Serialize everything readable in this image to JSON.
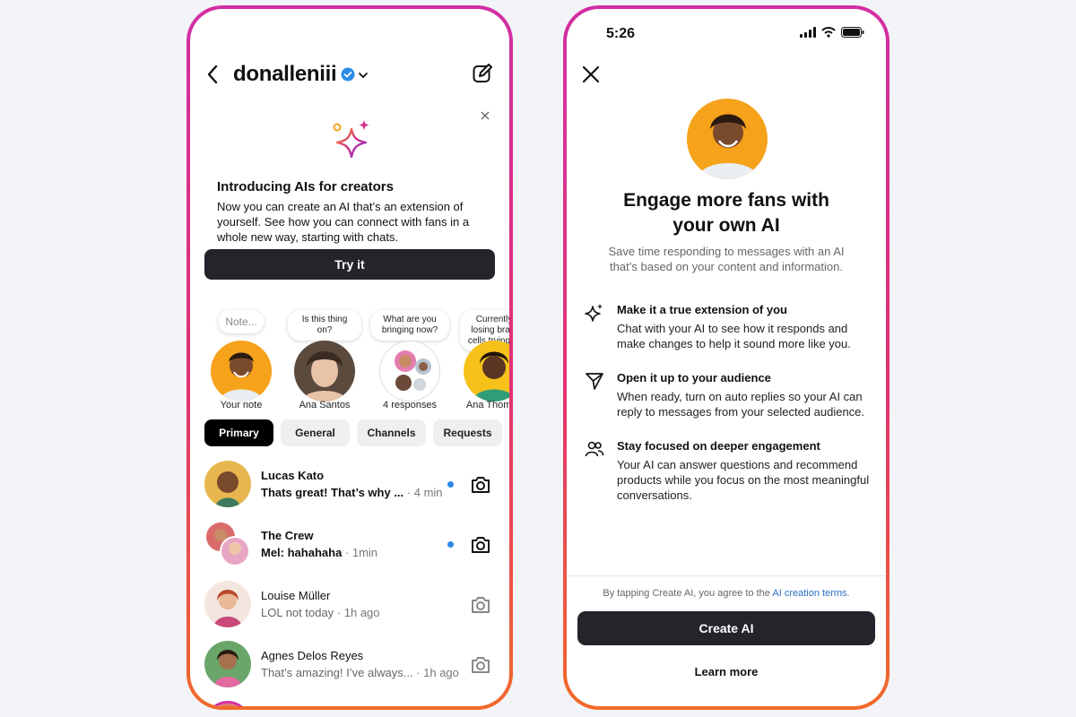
{
  "colors": {
    "accent_blue": "#2b8ae6",
    "button_dark": "#23252b",
    "frame_gradient": [
      "#d32ea4",
      "#e0336f",
      "#f26a2a"
    ],
    "avatar_orange": "#f6a21a"
  },
  "left": {
    "header": {
      "username": "donalleniii",
      "back_icon": "chevron-left-icon",
      "verified_icon": "verified-badge-icon",
      "compose_icon": "compose-icon"
    },
    "promo": {
      "title": "Introducing AIs for creators",
      "body": "Now you can create an AI that’s an extension of yourself. See how you can connect with fans in a whole new way, starting with chats.",
      "button": "Try it"
    },
    "notes": [
      {
        "bubble": "Note...",
        "name": "Your note"
      },
      {
        "bubble": "Is this thing on?",
        "name": "Ana Santos"
      },
      {
        "bubble": "What are you bringing now?",
        "name": "4 responses"
      },
      {
        "bubble": "Currently losing brain cells trying to",
        "name": "Ana Thomas"
      }
    ],
    "tabs": [
      "Primary",
      "General",
      "Channels",
      "Requests"
    ],
    "chats": [
      {
        "name": "Lucas Kato",
        "message": "Thats great! That’s why ...",
        "time": "· 4 min",
        "unread": true
      },
      {
        "name": "The Crew",
        "message": "Mel: hahahaha",
        "time": "· 1min",
        "unread": true
      },
      {
        "name": "Louise Müller",
        "message": "LOL not today",
        "time": "· 1h ago",
        "unread": false
      },
      {
        "name": "Agnes Delos Reyes",
        "message": "That’s amazing! I’ve always...",
        "time": "· 1h ago",
        "unread": false
      }
    ]
  },
  "right": {
    "status_time": "5:26",
    "title_line1": "Engage more fans with",
    "title_line2": "your own AI",
    "subtitle": "Save time responding to messages with an AI that’s based on your content and information.",
    "features": [
      {
        "icon": "sparkle-hand-icon",
        "title": "Make it a true extension of you",
        "body": "Chat with your AI to see how it responds and make changes to help it sound more like you."
      },
      {
        "icon": "send-icon",
        "title": "Open it up to your audience",
        "body": "When ready, turn on auto replies so your AI can reply to messages from your selected audience."
      },
      {
        "icon": "people-icon",
        "title": "Stay focused on deeper engagement",
        "body": "Your AI can answer questions and recommend products while you focus on the most meaningful conversations."
      }
    ],
    "terms_prefix": "By tapping Create AI, you agree to the ",
    "terms_link": "AI creation terms",
    "terms_suffix": ".",
    "create_button": "Create AI",
    "learn_more": "Learn more"
  }
}
